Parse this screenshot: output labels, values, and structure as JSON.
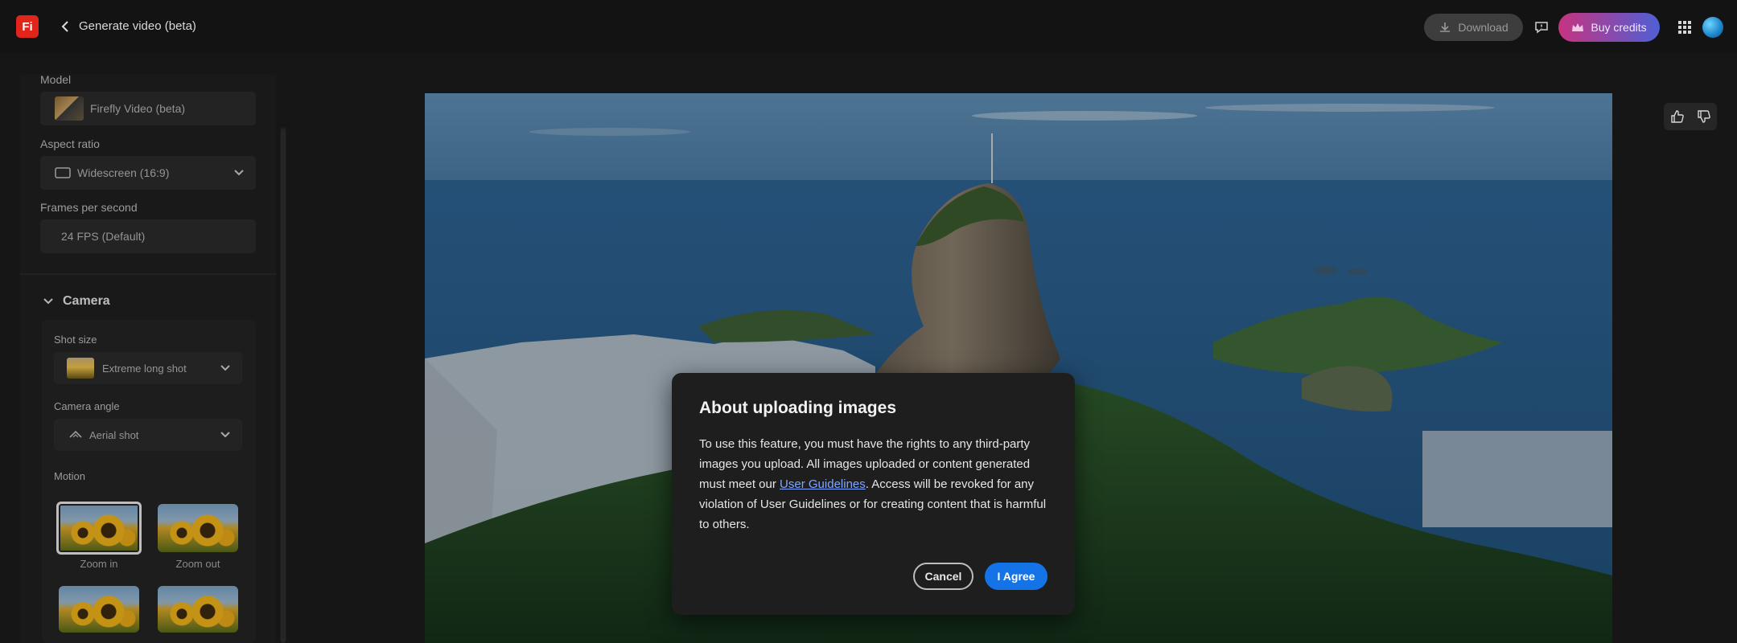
{
  "app": {
    "logo_text": "Fi",
    "title": "Generate video (beta)"
  },
  "header": {
    "download_label": "Download",
    "buy_credits_label": "Buy credits"
  },
  "sidebar": {
    "model_label": "Model",
    "model_value": "Firefly Video (beta)",
    "aspect_label": "Aspect ratio",
    "aspect_value": "Widescreen (16:9)",
    "fps_label": "Frames per second",
    "fps_value": "24 FPS (Default)",
    "camera_section": "Camera",
    "shot_size_label": "Shot size",
    "shot_size_value": "Extreme long shot",
    "camera_angle_label": "Camera angle",
    "camera_angle_value": "Aerial shot",
    "motion_label": "Motion",
    "motions": [
      {
        "label": "Zoom in",
        "selected": true
      },
      {
        "label": "Zoom out",
        "selected": false
      },
      {
        "label": "",
        "selected": false
      },
      {
        "label": "",
        "selected": false
      }
    ]
  },
  "modal": {
    "title": "About uploading images",
    "body_part1": "To use this feature, you must have the rights to any third-party images you upload. All images uploaded or content generated must meet our ",
    "link_text": "User Guidelines",
    "body_part2": ". Access will be revoked for any violation of User Guidelines or for creating content that is harmful to others.",
    "cancel_label": "Cancel",
    "agree_label": "I Agree"
  },
  "colors": {
    "accent": "#1473e6",
    "logo": "#e1251b",
    "background": "#1b1b1b"
  },
  "icons": [
    "chevron-left-icon",
    "download-icon",
    "feedback-icon",
    "crown-icon",
    "apps-grid-icon",
    "thumbs-up-icon",
    "thumbs-down-icon",
    "chevron-down-icon",
    "widescreen-icon",
    "aerial-icon"
  ]
}
